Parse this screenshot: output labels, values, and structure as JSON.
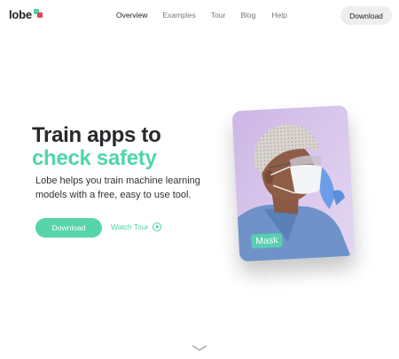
{
  "nav": {
    "logo": "lobe",
    "links": [
      "Overview",
      "Examples",
      "Tour",
      "Blog",
      "Help"
    ],
    "download_label": "Download"
  },
  "hero": {
    "headline_line1": "Train apps to",
    "headline_line2": "check safety",
    "subtext": "Lobe helps you train machine learning models with a free, easy to use tool.",
    "download_label": "Download",
    "watch_tour_label": "Watch Tour"
  },
  "card": {
    "label": "Mask"
  },
  "colors": {
    "accent": "#56d4ab",
    "logo_green": "#4fd2a8",
    "logo_red": "#e0445a",
    "card_background": "#d8c6ec"
  }
}
